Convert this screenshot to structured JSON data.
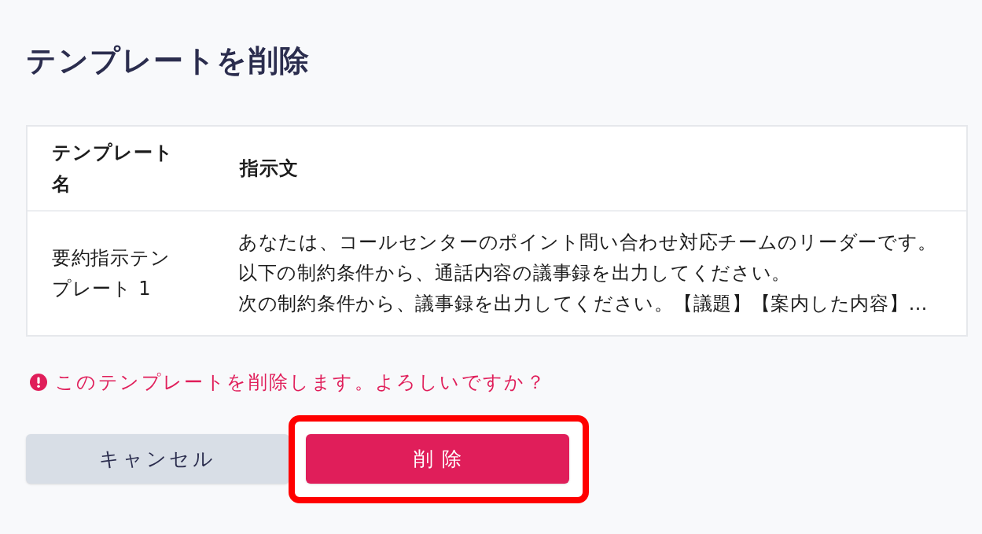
{
  "title": "テンプレートを削除",
  "table": {
    "columns": [
      "テンプレート名",
      "指示文"
    ],
    "rows": [
      {
        "name": "要約指示テンプレート 1",
        "instruction_lines": [
          "あなたは、コールセンターのポイント問い合わせ対応チームのリーダーです。",
          "以下の制約条件から、通話内容の議事録を出力してください。",
          "次の制約条件から、議事録を出力してください。【議題】【案内した内容】…"
        ]
      }
    ]
  },
  "alert": {
    "message": "このテンプレートを削除します。よろしいですか？"
  },
  "buttons": [
    {
      "label": "キャンセル",
      "kind": "secondary",
      "highlighted": false
    },
    {
      "label": "削除",
      "kind": "danger",
      "highlighted": true
    }
  ]
}
